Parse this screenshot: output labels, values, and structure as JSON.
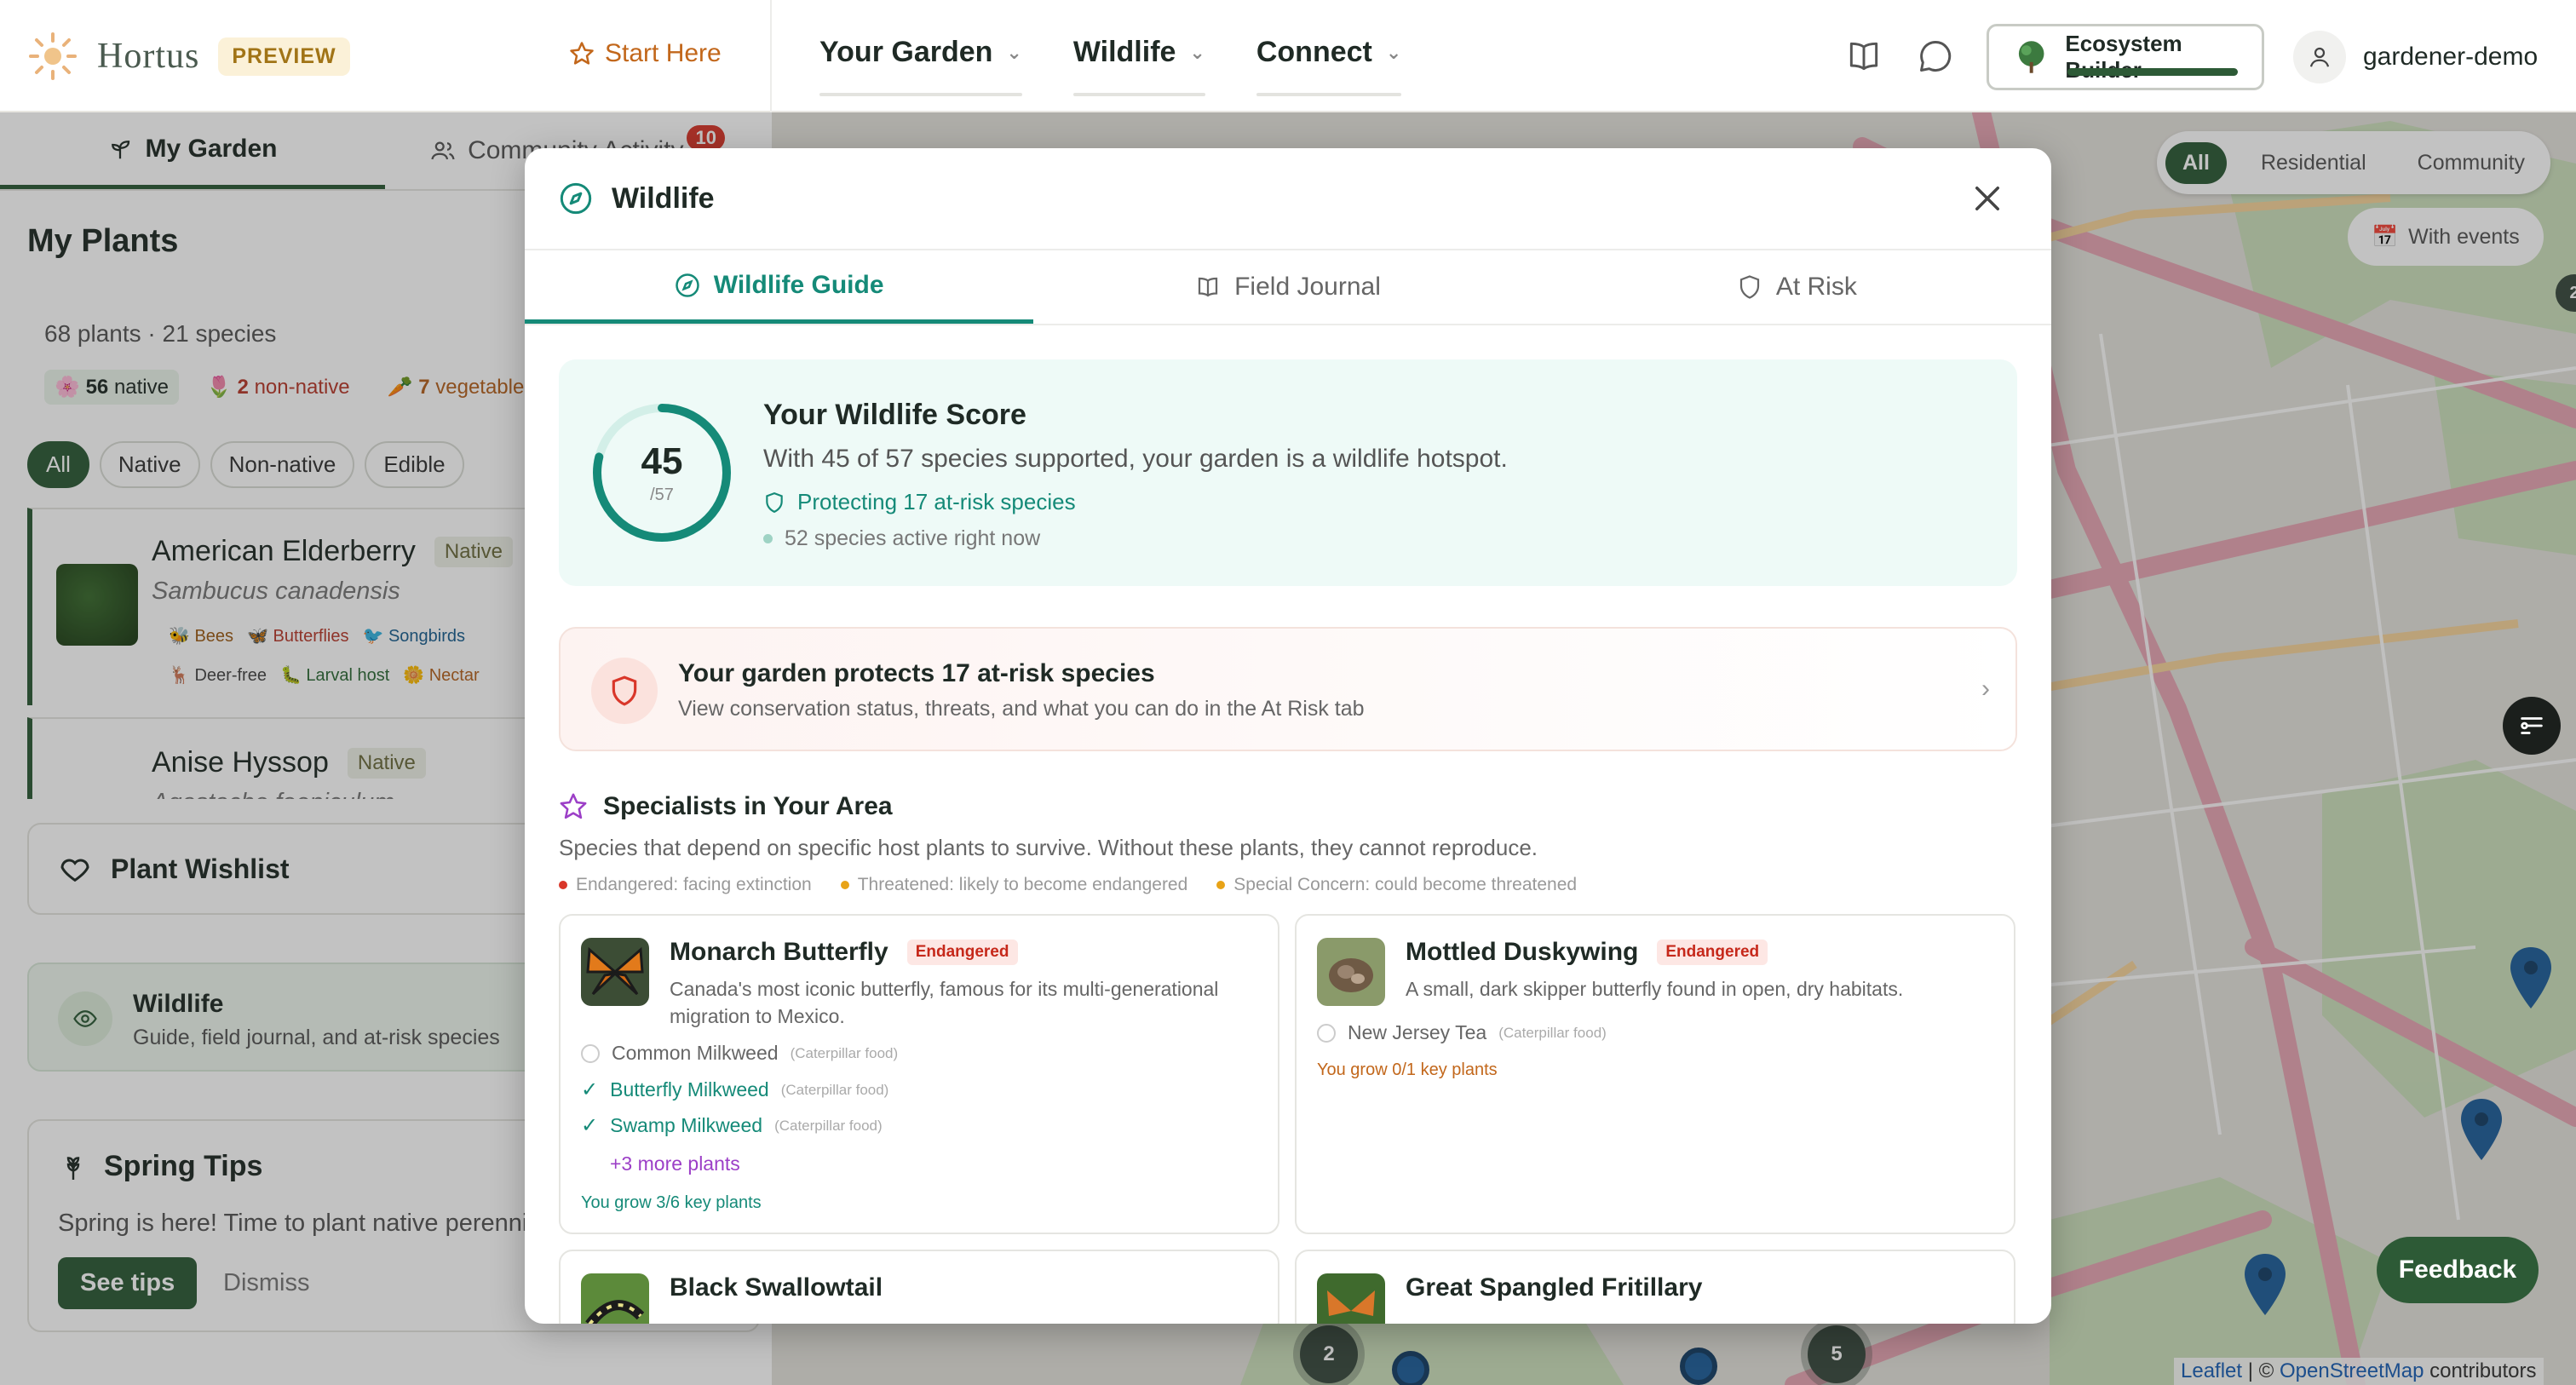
{
  "nav": {
    "brand": "Hortus",
    "preview": "PREVIEW",
    "start_here": "Start Here",
    "links": [
      "Your Garden",
      "Wildlife",
      "Connect"
    ],
    "ecosystem": "Ecosystem Builder",
    "username": "gardener-demo"
  },
  "sidebar": {
    "tabs": [
      "My Garden",
      "Community Activity"
    ],
    "community_badge": "10",
    "my_plants": "My Plants",
    "summary": "68 plants · 21 species",
    "counts": {
      "native": "56",
      "native_label": "native",
      "nonnative": "2",
      "nonnative_label": "non-native",
      "veg": "7",
      "veg_label": "vegetables"
    },
    "filters": [
      "All",
      "Native",
      "Non-native",
      "Edible"
    ],
    "plants": [
      {
        "name": "American Elderberry",
        "tag": "Native",
        "latin": "Sambucus canadensis",
        "traits": [
          "Bees",
          "Butterflies",
          "Songbirds",
          "Deer-free",
          "Larval host",
          "Nectar"
        ]
      },
      {
        "name": "Anise Hyssop",
        "tag": "Native",
        "latin": "Agastache foeniculum"
      }
    ],
    "wishlist": "Plant Wishlist",
    "wildlife_title": "Wildlife",
    "wildlife_desc": "Guide, field journal, and at-risk species",
    "tips_title": "Spring Tips",
    "tips_text": "Spring is here! Time to plant native perennials",
    "see_tips": "See tips",
    "dismiss": "Dismiss"
  },
  "map": {
    "chips": [
      "All",
      "Residential",
      "Community"
    ],
    "with_events": "With events",
    "feedback": "Feedback",
    "attribution": {
      "leaflet": "Leaflet",
      "sep": "| ©",
      "osm": "OpenStreetMap",
      "contrib": "contributors"
    },
    "clusters": [
      "2",
      "5",
      "2"
    ]
  },
  "modal": {
    "title": "Wildlife",
    "tabs": [
      "Wildlife Guide",
      "Field Journal",
      "At Risk"
    ],
    "score": {
      "value": "45",
      "total": "/57",
      "fraction": 0.789,
      "title": "Your Wildlife Score",
      "desc": "With 45 of 57 species supported, your garden is a wildlife hotspot.",
      "protecting": "Protecting 17 at-risk species",
      "active": "52 species active right now"
    },
    "atrisk": {
      "title": "Your garden protects 17 at-risk species",
      "desc": "View conservation status, threats, and what you can do in the At Risk tab"
    },
    "specialists": {
      "title": "Specialists in Your Area",
      "desc": "Species that depend on specific host plants to survive. Without these plants, they cannot reproduce.",
      "legend": [
        "Endangered: facing extinction",
        "Threatened: likely to become endangered",
        "Special Concern: could become threatened"
      ],
      "legend_colors": [
        "#d9372a",
        "#e8a317",
        "#e8a317"
      ]
    },
    "cards": [
      {
        "name": "Monarch Butterfly",
        "status": "Endangered",
        "desc": "Canada's most iconic butterfly, famous for its multi-generational migration to Mexico.",
        "plants": [
          {
            "name": "Common Milkweed",
            "note": "(Caterpillar food)",
            "grown": false
          },
          {
            "name": "Butterfly Milkweed",
            "note": "(Caterpillar food)",
            "grown": true
          },
          {
            "name": "Swamp Milkweed",
            "note": "(Caterpillar food)",
            "grown": true
          }
        ],
        "more": "+3 more plants",
        "grow": "You grow 3/6 key plants"
      },
      {
        "name": "Mottled Duskywing",
        "status": "Endangered",
        "desc": "A small, dark skipper butterfly found in open, dry habitats.",
        "plants": [
          {
            "name": "New Jersey Tea",
            "note": "(Caterpillar food)",
            "grown": false
          }
        ],
        "grow": "You grow 0/1 key plants"
      },
      {
        "name": "Black Swallowtail"
      },
      {
        "name": "Great Spangled Fritillary"
      }
    ]
  }
}
